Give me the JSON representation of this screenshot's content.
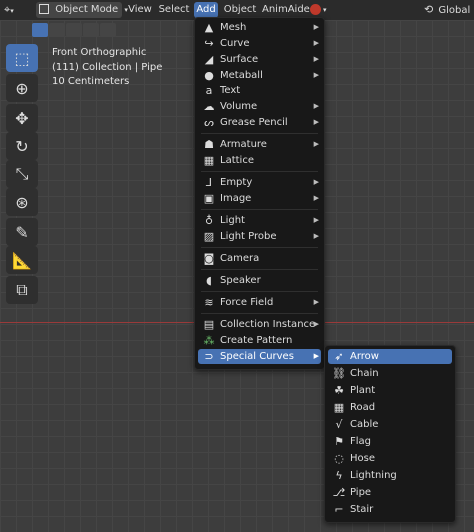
{
  "header": {
    "mode": "Object Mode",
    "menus": [
      "View",
      "Select",
      "Add",
      "Object",
      "AnimAide"
    ],
    "orientation": "Global",
    "active_menu_color": "#4772b3"
  },
  "viewport": {
    "view_name": "Front Orthographic",
    "collection": "(111) Collection | Pipe",
    "scale": "10 Centimeters"
  },
  "tools": [
    "select-box",
    "cursor",
    "move",
    "rotate",
    "scale",
    "transform",
    "annotate",
    "measure",
    "add-cube"
  ],
  "add_menu": [
    {
      "label": "Mesh",
      "icon": "mesh-icon",
      "submenu": true
    },
    {
      "label": "Curve",
      "icon": "curve-icon",
      "submenu": true
    },
    {
      "label": "Surface",
      "icon": "surface-icon",
      "submenu": true
    },
    {
      "label": "Metaball",
      "icon": "metaball-icon",
      "submenu": true
    },
    {
      "label": "Text",
      "icon": "text-icon",
      "submenu": false
    },
    {
      "label": "Volume",
      "icon": "volume-icon",
      "submenu": true
    },
    {
      "label": "Grease Pencil",
      "icon": "grease-pencil-icon",
      "submenu": true
    },
    {
      "label": "Armature",
      "icon": "armature-icon",
      "submenu": true
    },
    {
      "label": "Lattice",
      "icon": "lattice-icon",
      "submenu": false
    },
    {
      "label": "Empty",
      "icon": "empty-icon",
      "submenu": true
    },
    {
      "label": "Image",
      "icon": "image-icon",
      "submenu": true
    },
    {
      "label": "Light",
      "icon": "light-icon",
      "submenu": true
    },
    {
      "label": "Light Probe",
      "icon": "light-probe-icon",
      "submenu": true
    },
    {
      "label": "Camera",
      "icon": "camera-icon",
      "submenu": false
    },
    {
      "label": "Speaker",
      "icon": "speaker-icon",
      "submenu": false
    },
    {
      "label": "Force Field",
      "icon": "force-field-icon",
      "submenu": true
    },
    {
      "label": "Collection Instance",
      "icon": "collection-instance-icon",
      "submenu": true
    },
    {
      "label": "Create Pattern",
      "icon": "create-pattern-icon",
      "submenu": false
    },
    {
      "label": "Special Curves",
      "icon": "special-curves-icon",
      "submenu": true
    }
  ],
  "special_curves_menu": [
    {
      "label": "Arrow",
      "icon": "arrow-icon"
    },
    {
      "label": "Chain",
      "icon": "chain-icon"
    },
    {
      "label": "Plant",
      "icon": "plant-icon"
    },
    {
      "label": "Road",
      "icon": "road-icon"
    },
    {
      "label": "Cable",
      "icon": "cable-icon"
    },
    {
      "label": "Flag",
      "icon": "flag-icon"
    },
    {
      "label": "Hose",
      "icon": "hose-icon"
    },
    {
      "label": "Lightning",
      "icon": "lightning-icon"
    },
    {
      "label": "Pipe",
      "icon": "pipe-icon"
    },
    {
      "label": "Stair",
      "icon": "stair-icon"
    }
  ]
}
